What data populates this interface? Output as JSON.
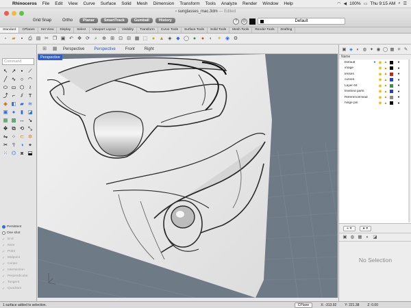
{
  "menubar": {
    "app": "Rhinoceros",
    "items": [
      "File",
      "Edit",
      "View",
      "Curve",
      "Surface",
      "Solid",
      "Mesh",
      "Dimension",
      "Transform",
      "Tools",
      "Analyze",
      "Render",
      "Window",
      "Help"
    ],
    "battery": "100%",
    "clock": "Thu 9:15 AM"
  },
  "window": {
    "title": "sunglasses_mac.3dm",
    "edited": "— Edited"
  },
  "snapbar": {
    "grid_snap": "Grid Snap",
    "ortho": "Ortho",
    "planar": "Planar",
    "smarttrack": "SmartTrack",
    "gumball": "Gumball",
    "history": "History"
  },
  "layer_dropdown": "Default",
  "toolbar_tabs": [
    "Standard",
    "CPlanes",
    "Set View",
    "Display",
    "Select",
    "Viewport Layout",
    "Visibility",
    "Transform",
    "Curve Tools",
    "Surface Tools",
    "Solid Tools",
    "Mesh Tools",
    "Render Tools",
    "Drafting"
  ],
  "command_placeholder": "Command",
  "viewport_tabs": [
    "Perspective",
    "Perspective",
    "Front",
    "Right"
  ],
  "viewport_label": "Perspective",
  "osnap": {
    "persistent": "Persistent",
    "one_shot": "One shot",
    "items": [
      "End",
      "Near",
      "Point",
      "Midpoint",
      "Center",
      "Intersection",
      "Perpendicular",
      "Tangent",
      "Quadrant"
    ]
  },
  "layers": {
    "header": "Name",
    "rows": [
      {
        "name": "Default",
        "color": "#000000",
        "current": true
      },
      {
        "name": "image",
        "color": "#000000",
        "current": false
      },
      {
        "name": "lenses",
        "color": "#d81c1c",
        "current": false
      },
      {
        "name": "curves",
        "color": "#1e3fd6",
        "current": false
      },
      {
        "name": "Layer 04",
        "color": "#23a030",
        "current": false
      },
      {
        "name": "finished parts",
        "color": "#1e3fd6",
        "current": false
      },
      {
        "name": "ReferenceHead",
        "color": "#8a8a8a",
        "current": false
      },
      {
        "name": "hinge pin",
        "color": "#000000",
        "current": false
      }
    ]
  },
  "properties": {
    "empty": "No Selection"
  },
  "status": {
    "message": "1 surface added to selection.",
    "cplane": "CPlane",
    "x": "X: -313.92",
    "y": "Y: 221.38",
    "z": "Z: 0.00"
  }
}
